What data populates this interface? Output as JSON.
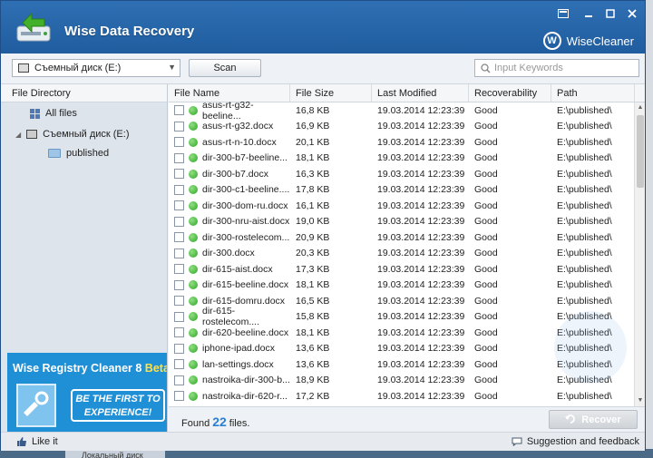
{
  "window": {
    "title": "Wise Data Recovery",
    "brand": "WiseCleaner",
    "brand_mark": "W"
  },
  "toolbar": {
    "drive_value": "Съемный диск (E:)",
    "scan_label": "Scan",
    "search_placeholder": "Input Keywords"
  },
  "tree": {
    "header": "File Directory",
    "all_files": "All files",
    "drive": "Съемный диск (E:)",
    "folder": "published"
  },
  "ad": {
    "title_main": "Wise Registry Cleaner 8",
    "title_beta": "Beta",
    "cta_line1": "BE THE FIRST TO",
    "cta_line2": "EXPERIENCE!"
  },
  "table": {
    "columns": [
      "File Name",
      "File Size",
      "Last Modified",
      "Recoverability",
      "Path"
    ],
    "rows": [
      {
        "name": "asus-rt-g32-beeline...",
        "size": "16,8 KB",
        "date": "19.03.2014 12:23:39",
        "rec": "Good",
        "path": "E:\\published\\"
      },
      {
        "name": "asus-rt-g32.docx",
        "size": "16,9 KB",
        "date": "19.03.2014 12:23:39",
        "rec": "Good",
        "path": "E:\\published\\"
      },
      {
        "name": "asus-rt-n-10.docx",
        "size": "20,1 KB",
        "date": "19.03.2014 12:23:39",
        "rec": "Good",
        "path": "E:\\published\\"
      },
      {
        "name": "dir-300-b7-beeline...",
        "size": "18,1 KB",
        "date": "19.03.2014 12:23:39",
        "rec": "Good",
        "path": "E:\\published\\"
      },
      {
        "name": "dir-300-b7.docx",
        "size": "16,3 KB",
        "date": "19.03.2014 12:23:39",
        "rec": "Good",
        "path": "E:\\published\\"
      },
      {
        "name": "dir-300-c1-beeline....",
        "size": "17,8 KB",
        "date": "19.03.2014 12:23:39",
        "rec": "Good",
        "path": "E:\\published\\"
      },
      {
        "name": "dir-300-dom-ru.docx",
        "size": "16,1 KB",
        "date": "19.03.2014 12:23:39",
        "rec": "Good",
        "path": "E:\\published\\"
      },
      {
        "name": "dir-300-nru-aist.docx",
        "size": "19,0 KB",
        "date": "19.03.2014 12:23:39",
        "rec": "Good",
        "path": "E:\\published\\"
      },
      {
        "name": "dir-300-rostelecom...",
        "size": "20,9 KB",
        "date": "19.03.2014 12:23:39",
        "rec": "Good",
        "path": "E:\\published\\"
      },
      {
        "name": "dir-300.docx",
        "size": "20,3 KB",
        "date": "19.03.2014 12:23:39",
        "rec": "Good",
        "path": "E:\\published\\"
      },
      {
        "name": "dir-615-aist.docx",
        "size": "17,3 KB",
        "date": "19.03.2014 12:23:39",
        "rec": "Good",
        "path": "E:\\published\\"
      },
      {
        "name": "dir-615-beeline.docx",
        "size": "18,1 KB",
        "date": "19.03.2014 12:23:39",
        "rec": "Good",
        "path": "E:\\published\\"
      },
      {
        "name": "dir-615-domru.docx",
        "size": "16,5 KB",
        "date": "19.03.2014 12:23:39",
        "rec": "Good",
        "path": "E:\\published\\"
      },
      {
        "name": "dir-615-rostelecom....",
        "size": "15,8 KB",
        "date": "19.03.2014 12:23:39",
        "rec": "Good",
        "path": "E:\\published\\"
      },
      {
        "name": "dir-620-beeline.docx",
        "size": "18,1 KB",
        "date": "19.03.2014 12:23:39",
        "rec": "Good",
        "path": "E:\\published\\"
      },
      {
        "name": "iphone-ipad.docx",
        "size": "13,6 KB",
        "date": "19.03.2014 12:23:39",
        "rec": "Good",
        "path": "E:\\published\\"
      },
      {
        "name": "lan-settings.docx",
        "size": "13,6 KB",
        "date": "19.03.2014 12:23:39",
        "rec": "Good",
        "path": "E:\\published\\"
      },
      {
        "name": "nastroika-dir-300-b...",
        "size": "18,9 KB",
        "date": "19.03.2014 12:23:39",
        "rec": "Good",
        "path": "E:\\published\\"
      },
      {
        "name": "nastroika-dir-620-r...",
        "size": "17,2 KB",
        "date": "19.03.2014 12:23:39",
        "rec": "Good",
        "path": "E:\\published\\"
      }
    ]
  },
  "status": {
    "found_prefix": "Found",
    "found_count": "22",
    "found_suffix": "files.",
    "recover_label": "Recover"
  },
  "footer": {
    "like_label": "Like it",
    "feedback_label": "Suggestion and feedback"
  },
  "desktop": {
    "tab_label": "Локальный диск"
  },
  "colors": {
    "title_bar": "#2f6fb3",
    "accent": "#2a7fd4",
    "good_dot": "#2fa52a"
  }
}
